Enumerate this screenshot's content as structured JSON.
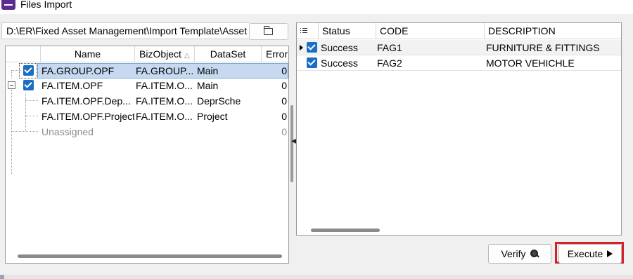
{
  "window": {
    "title": "Files Import"
  },
  "path_field": {
    "value": "D:\\ER\\Fixed Asset Management\\Import Template\\Asset"
  },
  "tree": {
    "columns": [
      "Name",
      "BizObject",
      "DataSet",
      "Error"
    ],
    "rows": [
      {
        "name": "FA.GROUP.OPF",
        "bizobject": "FA.GROUP...",
        "dataset": "Main",
        "error": "0",
        "checked": true,
        "selected": true
      },
      {
        "name": "FA.ITEM.OPF",
        "bizobject": "FA.ITEM.O...",
        "dataset": "Main",
        "error": "0",
        "checked": true,
        "expanded": true
      },
      {
        "name": "FA.ITEM.OPF.Dep...",
        "bizobject": "FA.ITEM.O...",
        "dataset": "DeprSche",
        "error": "0"
      },
      {
        "name": "FA.ITEM.OPF.Project",
        "bizobject": "FA.ITEM.O...",
        "dataset": "Project",
        "error": "0"
      },
      {
        "name": "Unassigned",
        "bizobject": "",
        "dataset": "",
        "error": "0",
        "muted": true
      }
    ]
  },
  "grid": {
    "columns": [
      "Status",
      "CODE",
      "DESCRIPTION"
    ],
    "rows": [
      {
        "status": "Success",
        "code": "FAG1",
        "description": "FURNITURE & FITTINGS",
        "checked": true,
        "current": true
      },
      {
        "status": "Success",
        "code": "FAG2",
        "description": "MOTOR VEHICHLE",
        "checked": true
      }
    ]
  },
  "buttons": {
    "verify": "Verify",
    "execute": "Execute"
  },
  "colors": {
    "highlight": "#d2232a",
    "checkbox": "#1a6fc4",
    "selection": "#c6d9f1"
  }
}
